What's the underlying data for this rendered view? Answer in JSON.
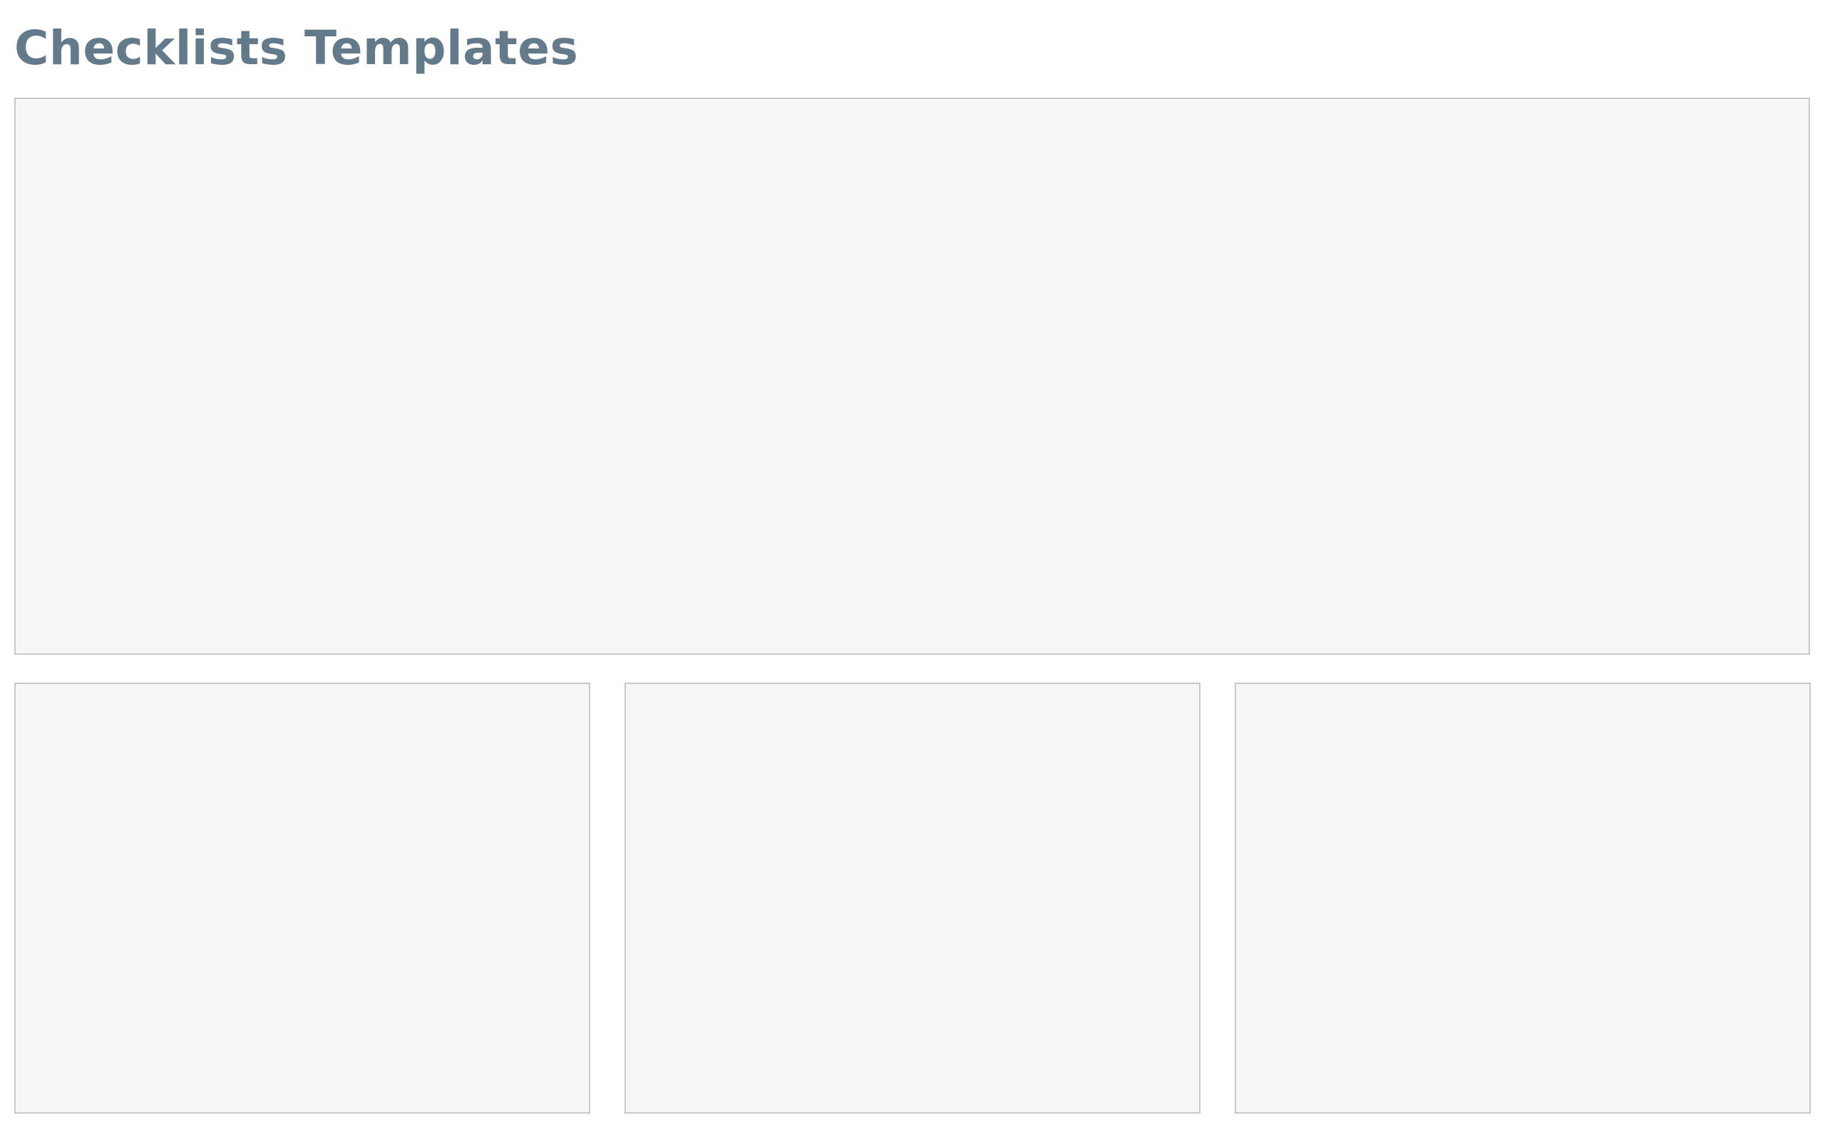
{
  "header": {
    "title": "Checklists Templates"
  },
  "colors": {
    "title_text": "#637a8b",
    "panel_background": "#f7f7f7",
    "panel_border": "#c8c8c8",
    "page_background": "#ffffff"
  },
  "panels": {
    "main": {},
    "cards": [
      {},
      {},
      {}
    ]
  }
}
